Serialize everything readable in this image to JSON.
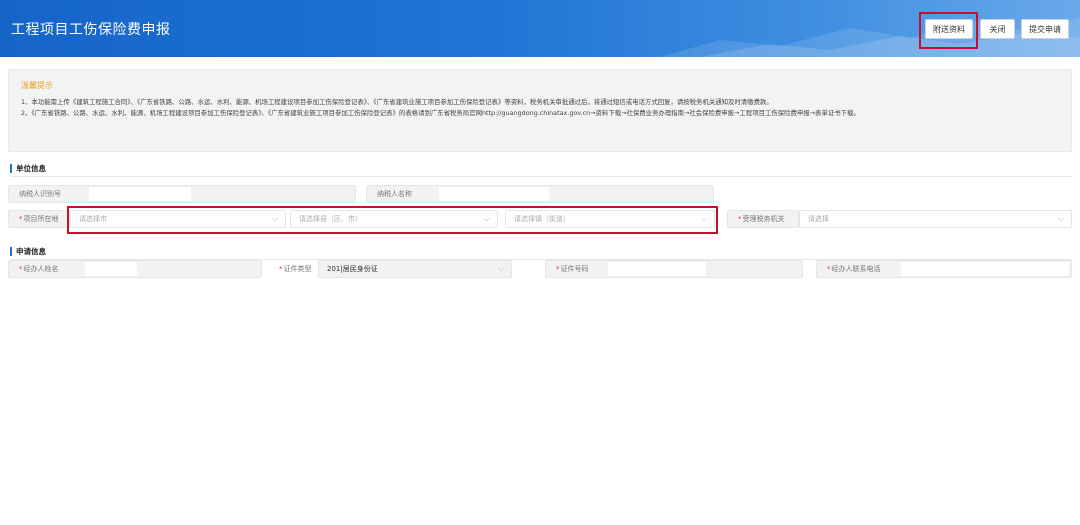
{
  "header": {
    "title": "工程项目工伤保险费申报",
    "buttons": {
      "attach": "附送资料",
      "close": "关闭",
      "submit": "提交申请"
    }
  },
  "notice": {
    "title": "温馨提示",
    "line1": "1、本功能需上传《建筑工程施工合同》、《广东省铁路、公路、水运、水利、能源、机场工程建设项目参加工伤保险登记表》、《广东省建筑业施工项目参加工伤保险登记表》等资料，税务机关审批通过后，将通过短信或电话方式回复，请按税务机关通知及时清缴费款。",
    "line2": "2、《广东省铁路、公路、水运、水利、能源、机场工程建设项目参加工伤保险登记表》、《广东省建筑业施工项目参加工伤保险登记表》的表格请到广东省税务局官网http://guangdong.chinatax.gov.cn→资料下载→社保费业务办理指南→社会保险费申报→工程项目工伤保险费申报→表单证书下载。"
  },
  "unit": {
    "section_title": "单位信息",
    "taxpayer_id_label": "纳税人识别号",
    "taxpayer_name_label": "纳税人名称",
    "project_location_label": "项目所在地",
    "city_placeholder": "请选择市",
    "county_placeholder": "请选择县（区、市）",
    "town_placeholder": "请选择镇（街道）",
    "tax_authority_label": "受理税务机关",
    "tax_authority_placeholder": "请选择"
  },
  "applicant": {
    "section_title": "申请信息",
    "agent_name_label": "经办人姓名",
    "id_type_label": "证件类型",
    "id_type_value": "201|居民身份证",
    "id_number_label": "证件号码",
    "phone_label": "经办人联系电话"
  },
  "colors": {
    "header": "#1f74d4",
    "highlight": "#c8102e",
    "notice_title": "#f0a01c"
  }
}
